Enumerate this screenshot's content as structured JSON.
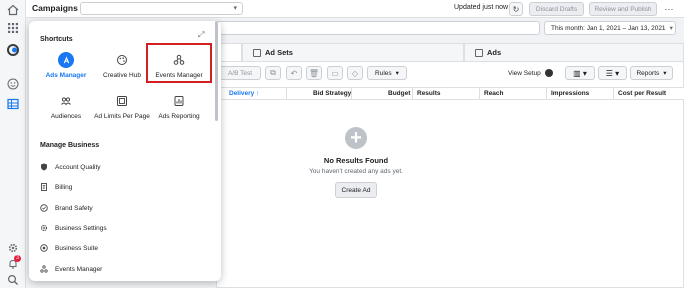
{
  "app": {
    "title": "Campaigns",
    "updated": "Updated just now",
    "discard_label": "Discard Drafts",
    "review_label": "Review and Publish",
    "more_label": "···"
  },
  "date_range": {
    "label": "This month: Jan 1, 2021 – Jan 13, 2021"
  },
  "tabs": [
    {
      "label": "Ad Sets"
    },
    {
      "label": "Ads"
    }
  ],
  "toolbar": {
    "ab_test": "A/B Test",
    "rules": "Rules",
    "view_setup": "View Setup",
    "reports": "Reports"
  },
  "table": {
    "columns": [
      "Delivery ↑",
      "Bid Strategy",
      "Budget",
      "Results",
      "Reach",
      "Impressions",
      "Cost per Result"
    ]
  },
  "empty_state": {
    "title": "No Results Found",
    "subtitle": "You haven't created any ads yet.",
    "create_label": "Create Ad"
  },
  "shortcuts": {
    "heading": "Shortcuts",
    "items": [
      {
        "label": "Ads Manager",
        "icon": "ads-manager-icon",
        "active": true
      },
      {
        "label": "Creative Hub",
        "icon": "palette-icon"
      },
      {
        "label": "Events Manager",
        "icon": "events-manager-icon"
      },
      {
        "label": "Audiences",
        "icon": "people-icon"
      },
      {
        "label": "Ad Limits Per Page",
        "icon": "ad-limits-icon"
      },
      {
        "label": "Ads Reporting",
        "icon": "report-icon"
      }
    ]
  },
  "manage_business": {
    "heading": "Manage Business",
    "items": [
      {
        "label": "Account Quality",
        "icon": "shield-icon"
      },
      {
        "label": "Billing",
        "icon": "billing-icon"
      },
      {
        "label": "Brand Safety",
        "icon": "brand-safety-icon"
      },
      {
        "label": "Business Settings",
        "icon": "gear-icon"
      },
      {
        "label": "Business Suite",
        "icon": "business-suite-icon"
      },
      {
        "label": "Events Manager",
        "icon": "events-manager-icon"
      }
    ]
  },
  "rail": {
    "notification_count": "3"
  },
  "colors": {
    "accent": "#1877f2",
    "highlight": "#d21f1f",
    "badge": "#e41e3f"
  }
}
